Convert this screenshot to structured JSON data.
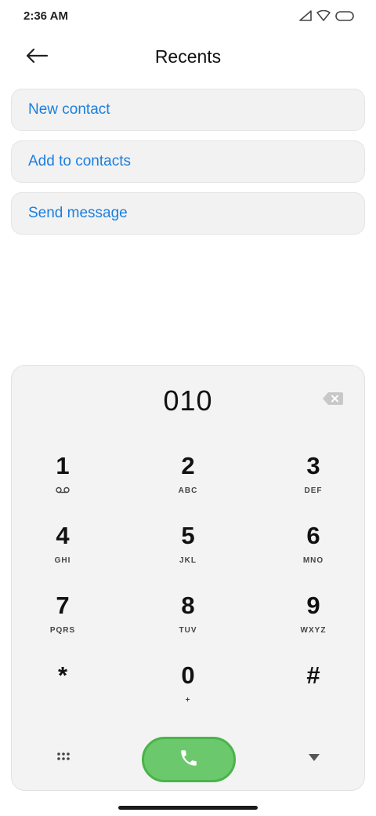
{
  "status_bar": {
    "time": "2:36 AM",
    "icons": [
      "signal-icon",
      "wifi-icon",
      "battery-icon"
    ]
  },
  "header": {
    "back_icon": "arrow-left-icon",
    "title": "Recents"
  },
  "actions": [
    {
      "label": "New contact"
    },
    {
      "label": "Add to contacts"
    },
    {
      "label": "Send message"
    }
  ],
  "dialpad": {
    "number": "010",
    "keys": [
      {
        "digit": "1",
        "sub": "",
        "sub_icon": "voicemail-icon"
      },
      {
        "digit": "2",
        "sub": "ABC"
      },
      {
        "digit": "3",
        "sub": "DEF"
      },
      {
        "digit": "4",
        "sub": "GHI"
      },
      {
        "digit": "5",
        "sub": "JKL"
      },
      {
        "digit": "6",
        "sub": "MNO"
      },
      {
        "digit": "7",
        "sub": "PQRS"
      },
      {
        "digit": "8",
        "sub": "TUV"
      },
      {
        "digit": "9",
        "sub": "WXYZ"
      },
      {
        "digit": "*",
        "sub": ""
      },
      {
        "digit": "0",
        "sub": "+"
      },
      {
        "digit": "#",
        "sub": ""
      }
    ],
    "bottom_icons": [
      "dialpad-grid-icon",
      "phone-icon",
      "chevron-down-icon"
    ]
  },
  "colors": {
    "accent": "#1a7fe0",
    "call_green": "#6cc86c",
    "panel_bg": "#f3f3f3"
  }
}
